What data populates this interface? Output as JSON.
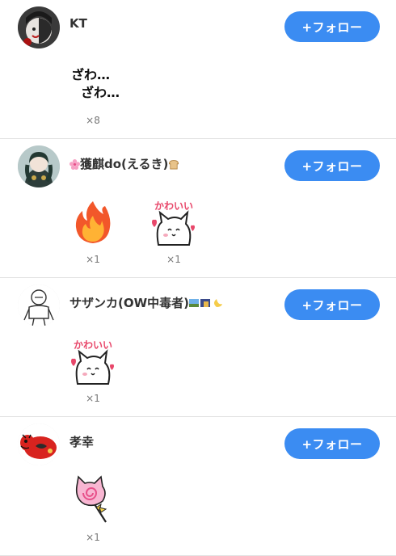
{
  "accent_color": "#3b8cf2",
  "users": [
    {
      "name": "KT",
      "follow_label": "+フォロー",
      "stamps": [
        {
          "icon": "zawa-zawa-text-stamp",
          "text_line1": "ざわ…",
          "text_line2": "ざわ…",
          "count": "×8"
        }
      ]
    },
    {
      "name": "獲麒do(えるき)",
      "name_prefix_icon": "sakura-flower-icon",
      "name_suffix_icon": "bread-icon",
      "follow_label": "+フォロー",
      "stamps": [
        {
          "icon": "fire-stamp",
          "count": "×1"
        },
        {
          "icon": "kawaii-cat-stamp",
          "label": "かわいい",
          "count": "×1"
        }
      ]
    },
    {
      "name": "サザンカ(OW中毒者)",
      "name_suffix_icon": "night-scenery-icons",
      "follow_label": "+フォロー",
      "stamps": [
        {
          "icon": "kawaii-cat-stamp",
          "label": "かわいい",
          "count": "×1"
        }
      ]
    },
    {
      "name": "孝幸",
      "follow_label": "+フォロー",
      "stamps": [
        {
          "icon": "lollipop-cat-stamp",
          "count": "×1"
        }
      ]
    }
  ]
}
